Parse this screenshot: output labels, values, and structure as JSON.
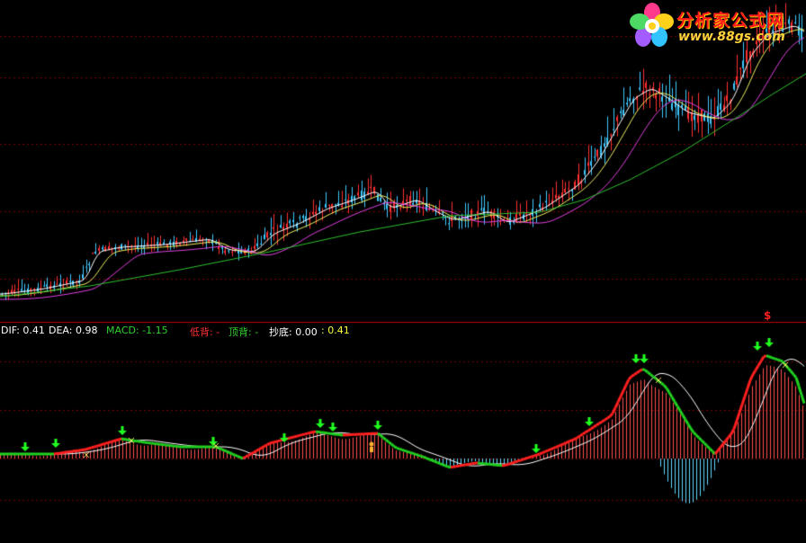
{
  "logo": {
    "title": "分析家公式网",
    "url": "www.88gs.com",
    "icon": "flower-logo-icon"
  },
  "signal_marker": "$",
  "indicator_legend": {
    "dif": "DIF: 0.41",
    "dea": "DEA: 0.98",
    "macd": "MACD: -1.15",
    "low_div": "低背: -",
    "top_div": "顶背: -",
    "bottom": "抄底: 0.00",
    "extra": ": 0.41"
  },
  "colors": {
    "background": "#000000",
    "grid": "#7a0000",
    "candle_up": "#ff3030",
    "candle_down": "#3ec8ff",
    "ma_white": "#ffffff",
    "ma_yellow": "#f0f060",
    "ma_magenta": "#e040e0",
    "ma_green": "#30c030",
    "dif_up": "#ff2020",
    "dif_down": "#20d020",
    "dea": "#ffffff",
    "hist_pos": "#ff5050",
    "hist_neg": "#60d8ff",
    "arrow": "#20ff20",
    "legend_white": "#ffffff",
    "legend_green": "#30d030",
    "legend_red": "#ff3030",
    "legend_yellow": "#ffff40"
  }
}
